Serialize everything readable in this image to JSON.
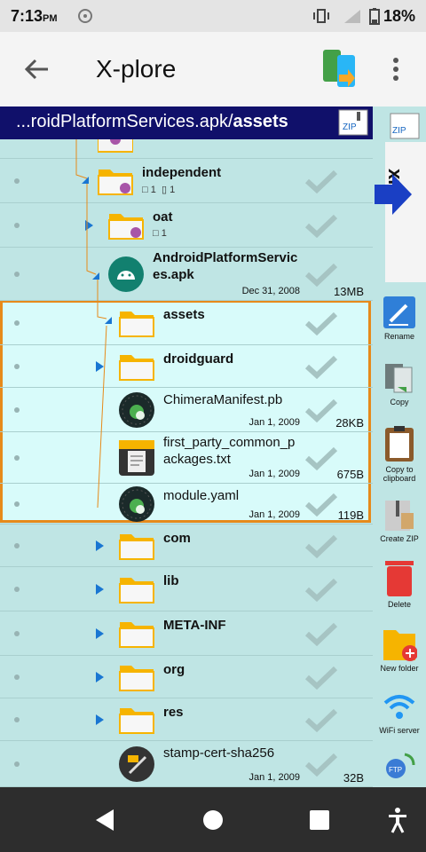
{
  "status": {
    "time": "7:13",
    "ampm": "PM",
    "battery": "18%"
  },
  "app": {
    "title": "X-plore"
  },
  "path": {
    "prefix": "...roidPlatformServices.apk/",
    "current": "assets"
  },
  "side_label": "xml",
  "tree": [
    {
      "name": "independent",
      "bold": true,
      "folders": "1",
      "files": "1"
    },
    {
      "name": "oat",
      "bold": true,
      "folders": "1"
    },
    {
      "name": "AndroidPlatformServic es.apk",
      "bold": true,
      "date": "Dec 31, 2008",
      "size": "13MB"
    },
    {
      "name": "assets",
      "bold": true
    },
    {
      "name": "droidguard",
      "bold": true
    },
    {
      "name": "ChimeraManifest.pb",
      "date": "Jan 1, 2009",
      "size": "28KB"
    },
    {
      "name": "first_party_common_p ackages.txt",
      "date": "Jan 1, 2009",
      "size": "675B"
    },
    {
      "name": "module.yaml",
      "date": "Jan 1, 2009",
      "size": "119B"
    },
    {
      "name": "com",
      "bold": true
    },
    {
      "name": "lib",
      "bold": true
    },
    {
      "name": "META-INF",
      "bold": true
    },
    {
      "name": "org",
      "bold": true
    },
    {
      "name": "res",
      "bold": true
    },
    {
      "name": "stamp-cert-sha256",
      "date": "Jan 1, 2009",
      "size": "32B"
    }
  ],
  "tools": [
    {
      "label": "Rename",
      "icon": "pencil-icon",
      "color": "#2f7fd8"
    },
    {
      "label": "Copy",
      "icon": "copy-icon",
      "color": "#7a8a8a"
    },
    {
      "label": "Copy to clipboard",
      "icon": "clipboard-icon",
      "color": "#8b5a2b"
    },
    {
      "label": "Create ZIP",
      "icon": "zip-icon",
      "color": "#8fa0a0"
    },
    {
      "label": "Delete",
      "icon": "trash-icon",
      "color": "#e53935"
    },
    {
      "label": "New folder",
      "icon": "new-folder-icon",
      "color": "#f6b400"
    },
    {
      "label": "WiFi server",
      "icon": "wifi-icon",
      "color": "#2196f3"
    },
    {
      "label": "FTP",
      "icon": "ftp-icon",
      "color": "#3a7bd5"
    }
  ]
}
